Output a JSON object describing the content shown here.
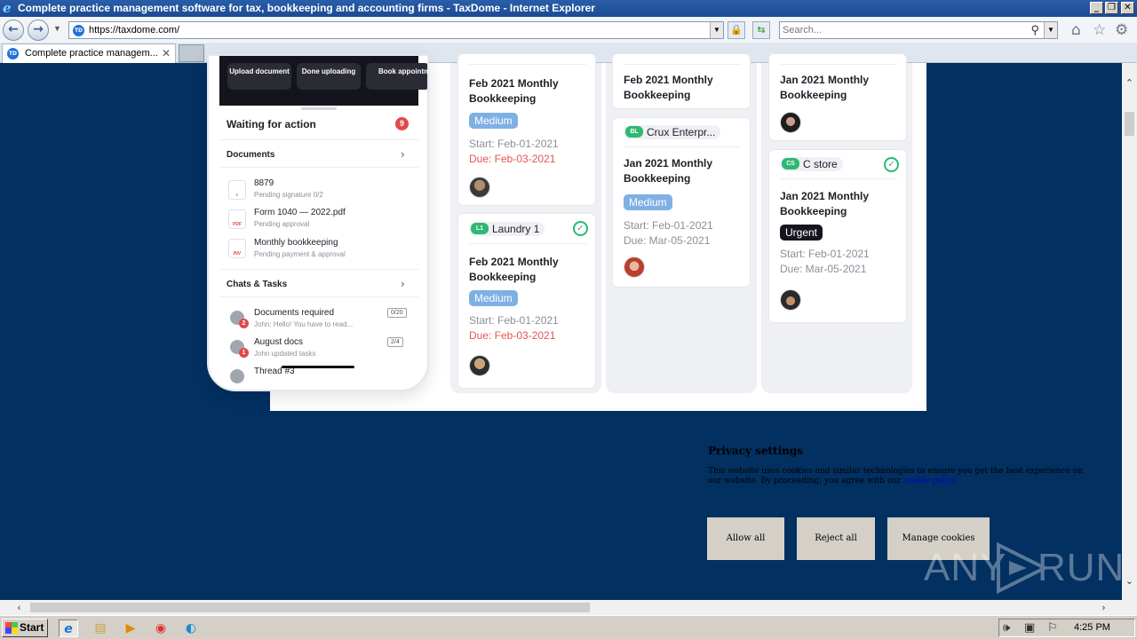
{
  "window": {
    "title": "Complete practice management software for tax, bookkeeping and accounting firms - TaxDome - Internet Explorer",
    "controls": {
      "minimize": "_",
      "restore": "❐",
      "close": "✕"
    }
  },
  "browser": {
    "url": "https://taxdome.com/",
    "search_placeholder": "Search...",
    "tab_label": "Complete practice managem...",
    "favicon_text": "TD"
  },
  "phone": {
    "quick_actions": [
      {
        "label": "Upload document"
      },
      {
        "label": "Done uploading"
      },
      {
        "label": "Book appointment"
      }
    ],
    "waiting_title": "Waiting for action",
    "waiting_count": "9",
    "documents_title": "Documents",
    "documents": [
      {
        "title": "8879",
        "sub": "Pending signature 0/2",
        "icon": "document-lock-icon"
      },
      {
        "title": "Form 1040 — 2022.pdf",
        "sub": "Pending approval",
        "icon": "pdf-icon"
      },
      {
        "title": "Monthly bookkeeping",
        "sub": "Pending payment & approval",
        "icon": "invoice-chart-icon"
      }
    ],
    "chats_title": "Chats & Tasks",
    "chats": [
      {
        "title": "Documents required",
        "sub": "John: Hello! You have to read...",
        "badge": "2",
        "count": "0/20"
      },
      {
        "title": "August docs",
        "sub": "John updated tasks",
        "badge": "1",
        "count": "2/4"
      },
      {
        "title": "Thread #3",
        "sub": "",
        "badge": "",
        "count": ""
      }
    ]
  },
  "board": {
    "col1": [
      {
        "title": "Feb 2021 Monthly Bookkeeping",
        "priority": "Medium",
        "start": "Start: Feb-01-2021",
        "due": "Due: Feb-03-2021"
      },
      {
        "client_initials": "L1",
        "client": "Laundry 1",
        "title": "Feb 2021 Monthly Bookkeeping",
        "priority": "Medium",
        "start": "Start: Feb-01-2021",
        "due": "Due: Feb-03-2021"
      }
    ],
    "col2": [
      {
        "title": "Feb 2021 Monthly Bookkeeping"
      },
      {
        "client_initials": "BL",
        "client": "Crux Enterpr...",
        "title": "Jan 2021 Monthly Bookkeeping",
        "priority": "Medium",
        "start": "Start: Feb-01-2021",
        "due": "Due: Mar-05-2021"
      }
    ],
    "col3": [
      {
        "title": "Jan 2021 Monthly Bookkeeping"
      },
      {
        "client_initials": "CS",
        "client": "C store",
        "title": "Jan 2021 Monthly Bookkeeping",
        "priority": "Urgent",
        "start": "Start: Feb-01-2021",
        "due": "Due: Mar-05-2021"
      }
    ]
  },
  "privacy": {
    "title": "Privacy settings",
    "text": "This website uses cookies and similar technologies to ensure you get the best experience on our website. By proceeding, you agree with our",
    "link": "cookie policy",
    "text_end": ".",
    "buttons": {
      "allow": "Allow all",
      "reject": "Reject all",
      "manage": "Manage cookies"
    }
  },
  "watermark": {
    "left": "ANY",
    "right": "RUN"
  },
  "taskbar": {
    "start": "Start",
    "clock": "4:25 PM"
  },
  "colors": {
    "page_bg": "#023061",
    "medium": "#7fb0e4",
    "urgent": "#15161d",
    "due_red": "#e25555",
    "check_green": "#2eb872"
  }
}
